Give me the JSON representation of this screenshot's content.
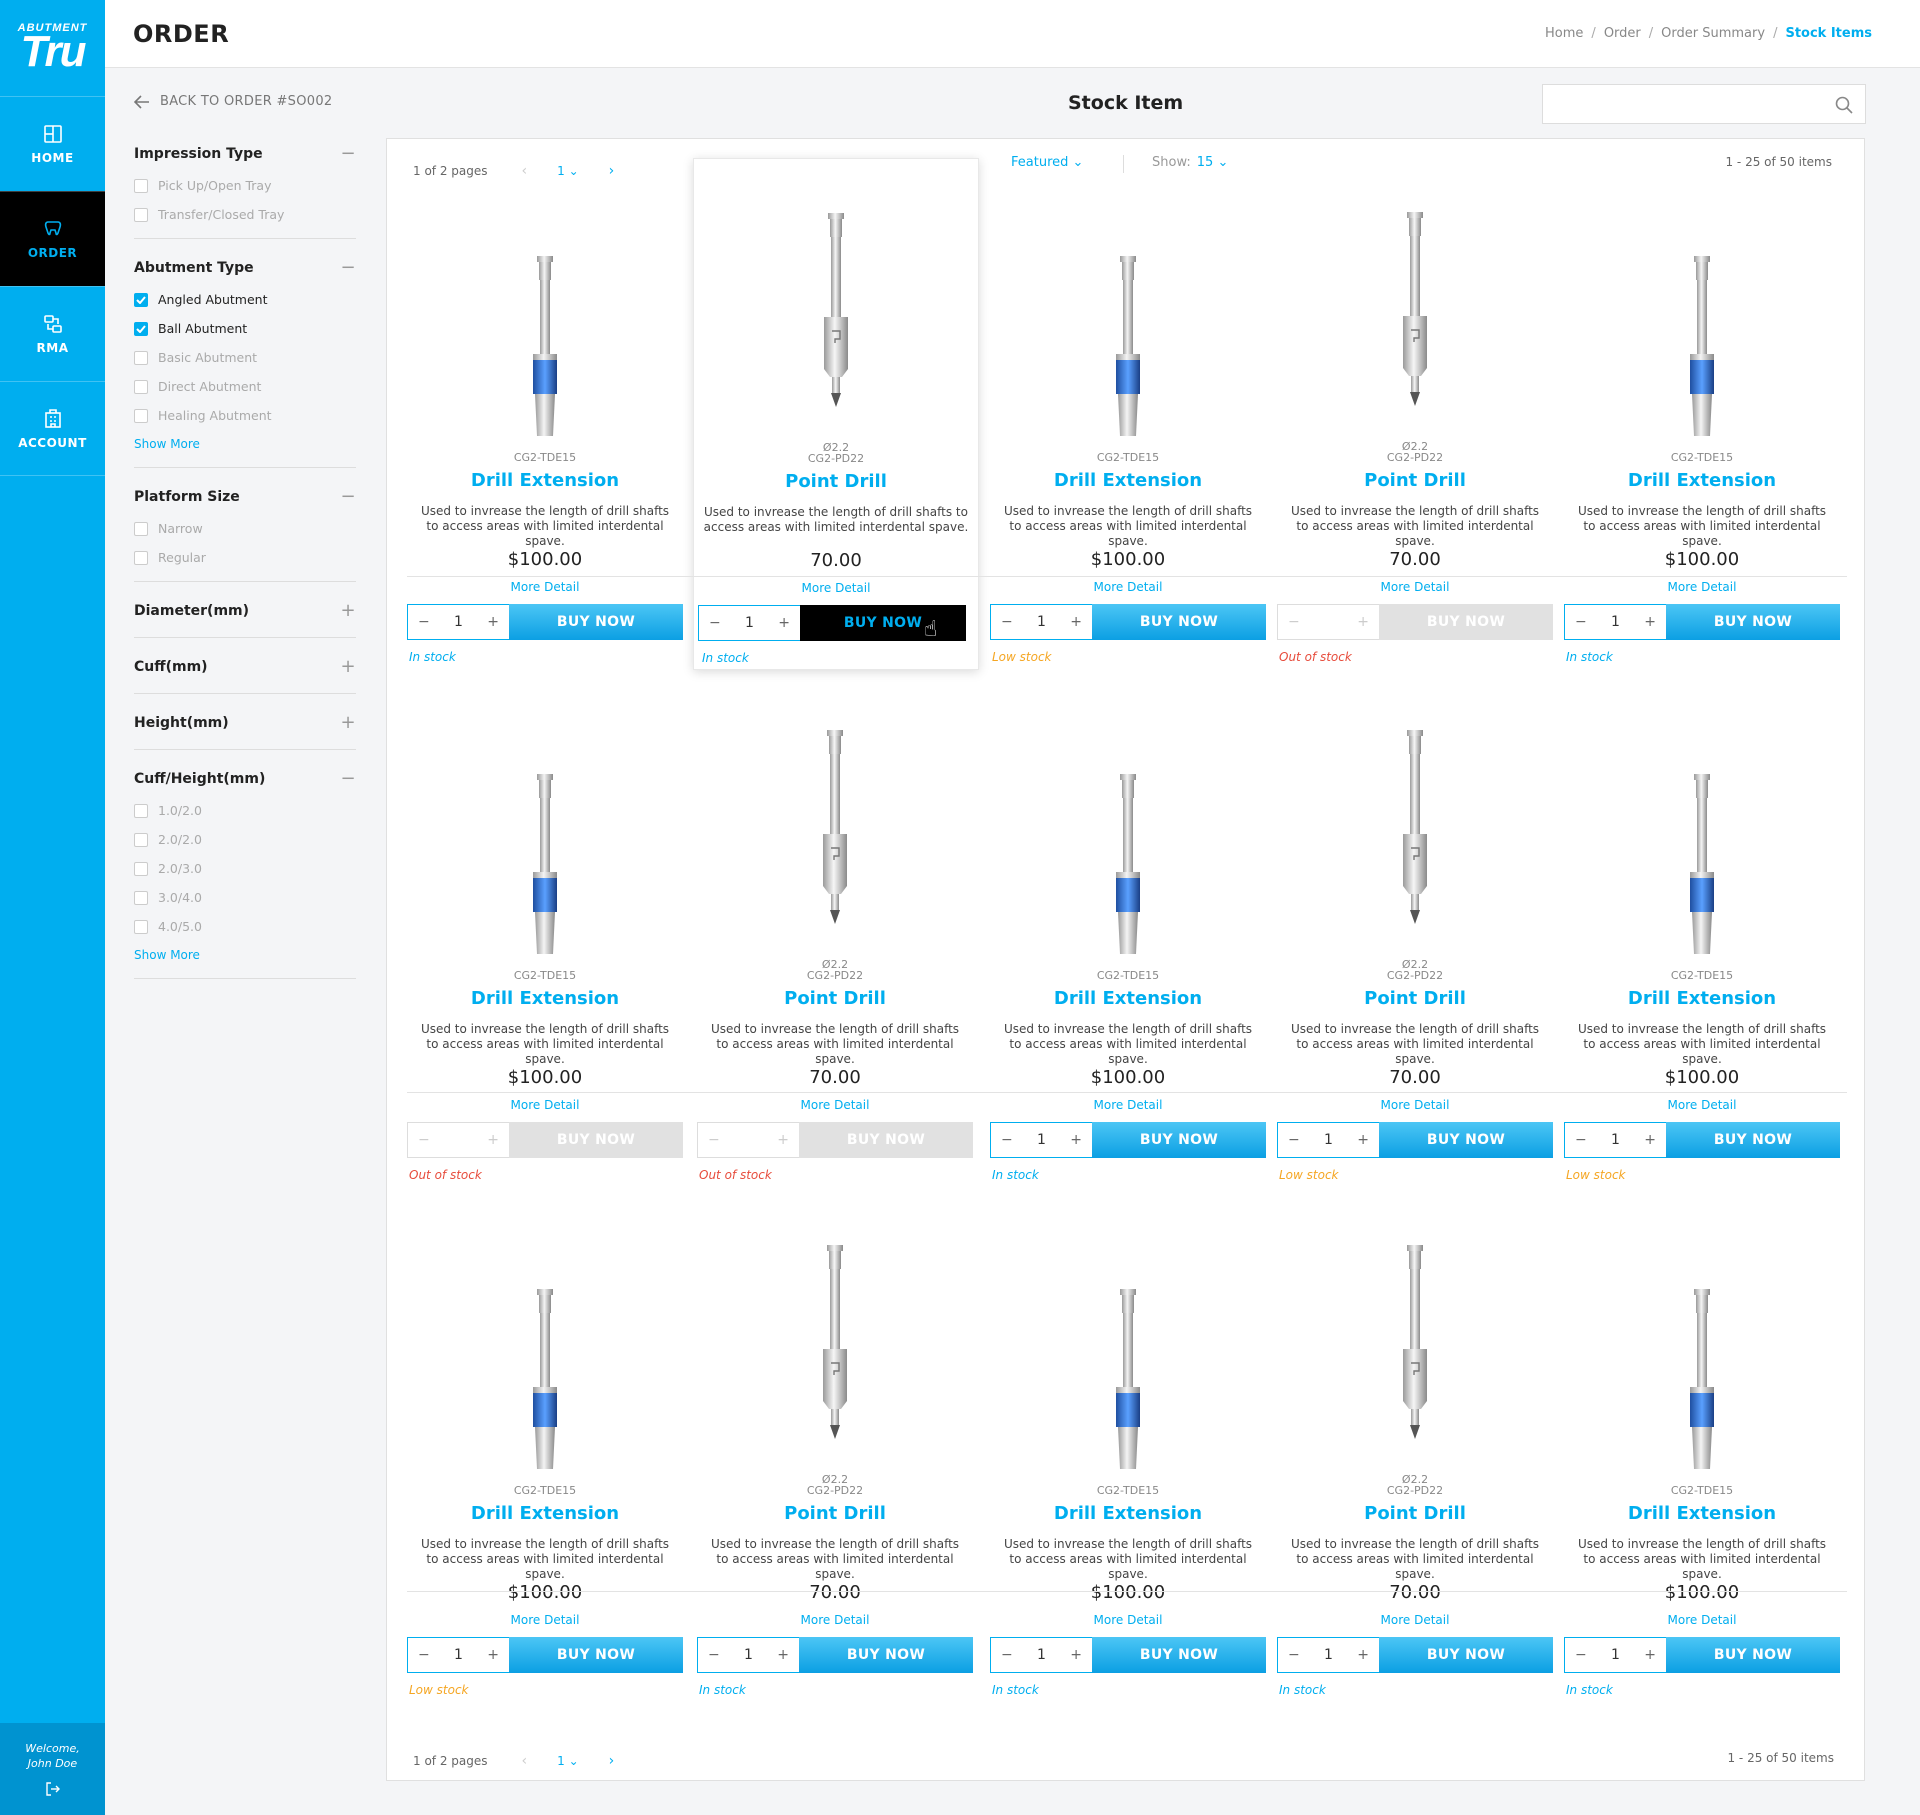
{
  "nav": {
    "logo_small": "ABUTMENT",
    "logo_big": "Tru",
    "items": [
      {
        "label": "HOME",
        "icon": "home-icon"
      },
      {
        "label": "ORDER",
        "icon": "tooth-icon"
      },
      {
        "label": "RMA",
        "icon": "return-icon"
      },
      {
        "label": "ACCOUNT",
        "icon": "building-icon"
      }
    ],
    "welcome": "Welcome,",
    "user": "John Doe"
  },
  "header": {
    "title": "ORDER",
    "breadcrumbs": [
      "Home",
      "Order",
      "Order Summary",
      "Stock Items"
    ]
  },
  "back": "BACK TO ORDER #SO002",
  "page_heading": "Stock Item",
  "search": {
    "placeholder": ""
  },
  "filters": {
    "impression": {
      "title": "Impression Type",
      "options": [
        "Pick Up/Open Tray",
        "Transfer/Closed Tray"
      ]
    },
    "abutment": {
      "title": "Abutment Type",
      "options": [
        "Angled Abutment",
        "Ball Abutment",
        "Basic Abutment",
        "Direct Abutment",
        "Healing Abutment"
      ],
      "checked": [
        true,
        true,
        false,
        false,
        false
      ]
    },
    "platform": {
      "title": "Platform Size",
      "options": [
        "Narrow",
        "Regular"
      ]
    },
    "diameter": {
      "title": "Diameter(mm)"
    },
    "cuff": {
      "title": "Cuff(mm)"
    },
    "height": {
      "title": "Height(mm)"
    },
    "cuffheight": {
      "title": "Cuff/Height(mm)",
      "options": [
        "1.0/2.0",
        "2.0/2.0",
        "2.0/3.0",
        "3.0/4.0",
        "4.0/5.0"
      ]
    },
    "show_more": "Show More"
  },
  "toolbar": {
    "sort": "Featured",
    "show_label": "Show:",
    "show_value": "15",
    "count": "1 - 25 of 50 items",
    "pages": "1 of 2 pages",
    "page": "1"
  },
  "common": {
    "desc": "Used to invrease the length of drill shafts to access areas with limited interdental spave.",
    "more": "More Detail",
    "buy": "BUY NOW",
    "qty": "1"
  },
  "products": [
    {
      "code": "CG2-TDE15",
      "dim": "",
      "name": "Drill Extension",
      "price": "$100.00",
      "stock": "In stock",
      "status": "in",
      "type": "ext"
    },
    {
      "code": "CG2-PD22",
      "dim": "Ø2.2",
      "name": "Point Drill",
      "price": "70.00",
      "stock": "In stock",
      "status": "in",
      "type": "drill",
      "hover": true
    },
    {
      "code": "CG2-TDE15",
      "dim": "",
      "name": "Drill Extension",
      "price": "$100.00",
      "stock": "Low stock",
      "status": "low",
      "type": "ext"
    },
    {
      "code": "CG2-PD22",
      "dim": "Ø2.2",
      "name": "Point Drill",
      "price": "70.00",
      "stock": "Out of stock",
      "status": "out",
      "type": "drill"
    },
    {
      "code": "CG2-TDE15",
      "dim": "",
      "name": "Drill Extension",
      "price": "$100.00",
      "stock": "In stock",
      "status": "in",
      "type": "ext"
    },
    {
      "code": "CG2-TDE15",
      "dim": "",
      "name": "Drill Extension",
      "price": "$100.00",
      "stock": "Out of stock",
      "status": "out",
      "type": "ext"
    },
    {
      "code": "CG2-PD22",
      "dim": "Ø2.2",
      "name": "Point Drill",
      "price": "70.00",
      "stock": "Out of stock",
      "status": "out",
      "type": "drill"
    },
    {
      "code": "CG2-TDE15",
      "dim": "",
      "name": "Drill Extension",
      "price": "$100.00",
      "stock": "In stock",
      "status": "in",
      "type": "ext"
    },
    {
      "code": "CG2-PD22",
      "dim": "Ø2.2",
      "name": "Point Drill",
      "price": "70.00",
      "stock": "Low stock",
      "status": "low",
      "type": "drill"
    },
    {
      "code": "CG2-TDE15",
      "dim": "",
      "name": "Drill Extension",
      "price": "$100.00",
      "stock": "Low stock",
      "status": "low",
      "type": "ext"
    },
    {
      "code": "CG2-TDE15",
      "dim": "",
      "name": "Drill Extension",
      "price": "$100.00",
      "stock": "Low stock",
      "status": "low",
      "type": "ext"
    },
    {
      "code": "CG2-PD22",
      "dim": "Ø2.2",
      "name": "Point Drill",
      "price": "70.00",
      "stock": "In stock",
      "status": "in",
      "type": "drill"
    },
    {
      "code": "CG2-TDE15",
      "dim": "",
      "name": "Drill Extension",
      "price": "$100.00",
      "stock": "In stock",
      "status": "in",
      "type": "ext"
    },
    {
      "code": "CG2-PD22",
      "dim": "Ø2.2",
      "name": "Point Drill",
      "price": "70.00",
      "stock": "In stock",
      "status": "in",
      "type": "drill"
    },
    {
      "code": "CG2-TDE15",
      "dim": "",
      "name": "Drill Extension",
      "price": "$100.00",
      "stock": "In stock",
      "status": "in",
      "type": "ext"
    }
  ]
}
